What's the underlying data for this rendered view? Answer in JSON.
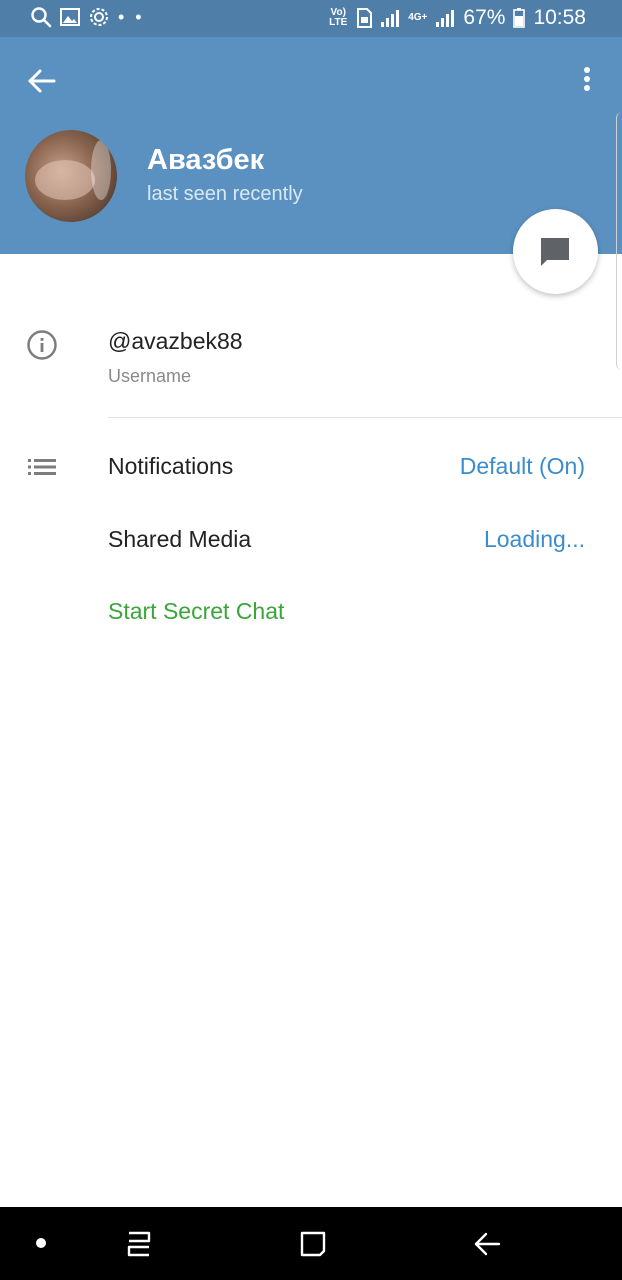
{
  "status_bar": {
    "battery": "67%",
    "time": "10:58",
    "volte": "Vo) LTE",
    "network": "4G+",
    "notif_dots": "• •"
  },
  "profile": {
    "name": "Авазбек",
    "status": "last seen recently"
  },
  "info": {
    "username_value": "@avazbek88",
    "username_label": "Username"
  },
  "rows": {
    "notifications_label": "Notifications",
    "notifications_value": "Default (On)",
    "shared_media_label": "Shared Media",
    "shared_media_value": "Loading...",
    "secret_chat_label": "Start Secret Chat"
  },
  "colors": {
    "header": "#5b91c0",
    "status_bar": "#4f7fa8",
    "accent_value": "#3a8ccc",
    "secret_green": "#3aa639"
  },
  "icons": [
    "search-icon",
    "image-icon",
    "settings-icon",
    "volte-icon",
    "sim-icon",
    "signal-icon",
    "battery-icon",
    "back-arrow-icon",
    "more-vert-icon",
    "message-icon",
    "info-icon",
    "list-icon",
    "nav-dot-icon",
    "recents-icon",
    "home-icon",
    "nav-back-icon"
  ]
}
